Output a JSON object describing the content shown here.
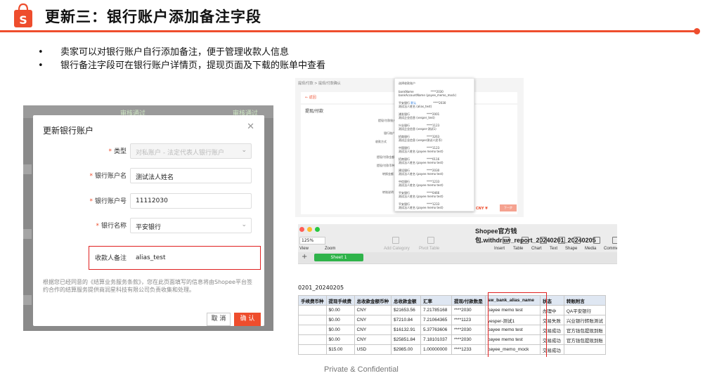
{
  "slide": {
    "title": "更新三：银行账户添加备注字段",
    "bullets": [
      "卖家可以对银行账户自行添加备注，便于管理收款人信息",
      "银行备注字段可在银行账户详情页，提现页面及下载的账单中查看"
    ],
    "footer": "Private & Confidential",
    "accent_color": "#ee4d2d",
    "logo_icon": "shopee-bag-icon"
  },
  "modal": {
    "bg_tags": [
      "审核通过",
      "审核通过"
    ],
    "title": "更新银行账户",
    "fields": [
      {
        "label": "类型",
        "required": true,
        "value": "对私账户 - 法定代表人银行账户",
        "disabled": true,
        "select": true
      },
      {
        "label": "银行账户名",
        "required": true,
        "value": "测试法人姓名",
        "disabled": false,
        "select": false
      },
      {
        "label": "银行账户号",
        "required": true,
        "value": "11112030",
        "disabled": false,
        "select": false
      },
      {
        "label": "银行名称",
        "required": true,
        "value": "平安银行",
        "disabled": false,
        "select": true
      },
      {
        "label": "收款人备注",
        "required": false,
        "value": "alias_test",
        "disabled": false,
        "select": false
      }
    ],
    "note": "根据您已经同意的《结算业务服务条款》，您在此页面填写的信息将由Shopee平台签约合作的结算服务提供商润星科技有限公司负责收集和处理。",
    "cancel": "取 消",
    "confirm": "确 认"
  },
  "withdraw": {
    "breadcrumb": "提现/付款 > 提现/付款确认",
    "back": "← 返回",
    "form_title": "提现/付款",
    "labels": [
      "提现/付款账户",
      "银行账户",
      "收款方式",
      "提现/付款金额",
      "提现/付款币种",
      "转换金额",
      "转账说明"
    ],
    "currency": "CNY ¥",
    "submit": "下一步",
    "dropdown_header": "选择收款账户",
    "dropdown": [
      {
        "name": "bankName",
        "num": "****2030",
        "alias": "bankAccountName (payee_memo_mock)"
      },
      {
        "name": "平安银行",
        "num": "****2030",
        "alias": "测试法人姓名 (alias_test)",
        "tag": "默认"
      },
      {
        "name": "浦发银行",
        "num": "****2001",
        "alias": "测试企业信息 (vesper_test)"
      },
      {
        "name": "兴业银行",
        "num": "****1123",
        "alias": "测试企业信息 (vesper-测试1)"
      },
      {
        "name": "招商银行",
        "num": "****3263",
        "alias": "测试企业信息 (vesper测试人民币)"
      },
      {
        "name": "中国银行",
        "num": "****1123",
        "alias": "测试法人姓名 (payee memo test)"
      },
      {
        "name": "招商银行",
        "num": "****0116",
        "alias": "测试法人姓名 (payee memo test)"
      },
      {
        "name": "建设银行",
        "num": "****2030",
        "alias": "测试法人姓名 (payee memo test)"
      },
      {
        "name": "中信银行",
        "num": "****1233",
        "alias": "测试法人姓名 (payee memo test)"
      },
      {
        "name": "平安银行",
        "num": "****0466",
        "alias": "测试法人姓名 (payee memo test)"
      },
      {
        "name": "平安银行",
        "num": "****1233",
        "alias": "测试法人姓名 (payee memo test)"
      }
    ]
  },
  "sheet": {
    "title": "Shopee官方钱包.withdraw_report_20240201_20240205",
    "zoom": "125%",
    "tools": [
      {
        "label": "View",
        "icon": "view-icon",
        "dim": false
      },
      {
        "label": "Zoom",
        "icon": "zoom-icon",
        "dim": false
      },
      {
        "label": "Add Category",
        "icon": "add-category-icon",
        "dim": true
      },
      {
        "label": "Pivot Table",
        "icon": "pivot-table-icon",
        "dim": true
      },
      {
        "label": "Insert",
        "icon": "insert-icon",
        "dim": false
      },
      {
        "label": "Table",
        "icon": "table-icon",
        "dim": false
      },
      {
        "label": "Chart",
        "icon": "chart-icon",
        "dim": false
      },
      {
        "label": "Text",
        "icon": "text-icon",
        "dim": false
      },
      {
        "label": "Shape",
        "icon": "shape-icon",
        "dim": false
      },
      {
        "label": "Media",
        "icon": "media-icon",
        "dim": false
      },
      {
        "label": "Comment",
        "icon": "comment-icon",
        "dim": false
      }
    ],
    "tab": "Sheet 1",
    "sheet_name": "0201_20240205",
    "headers": [
      "手续费币种",
      "提现手续费",
      "总收款金额币种",
      "总收款金额",
      "汇率",
      "提现/付款数是",
      "sw_bank_alias_name",
      "状态",
      "转账附言"
    ],
    "rows": [
      [
        "",
        "$0.00",
        "CNY",
        "$21653.56",
        "7.21785168",
        "****2030",
        "payee memo test",
        "办理中",
        "QA平安银行"
      ],
      [
        "",
        "$0.00",
        "CNY",
        "$7210.84",
        "7.21064365",
        "****1123",
        "vesper-测试1",
        "交易失败",
        "兴业银行转账测试"
      ],
      [
        "",
        "$0.00",
        "CNY",
        "$16132.91",
        "5.37763606",
        "****2030",
        "payee memo test",
        "交易成功",
        "官方钱包提现到账"
      ],
      [
        "",
        "$0.00",
        "CNY",
        "$25851.84",
        "7.18101037",
        "****2030",
        "payee memo test",
        "交易成功",
        "官方钱包提现到账"
      ],
      [
        "",
        "$15.00",
        "USD",
        "$2985.00",
        "1.00000000",
        "****1233",
        "payee_memo_mock",
        "交易成功",
        ""
      ]
    ]
  }
}
